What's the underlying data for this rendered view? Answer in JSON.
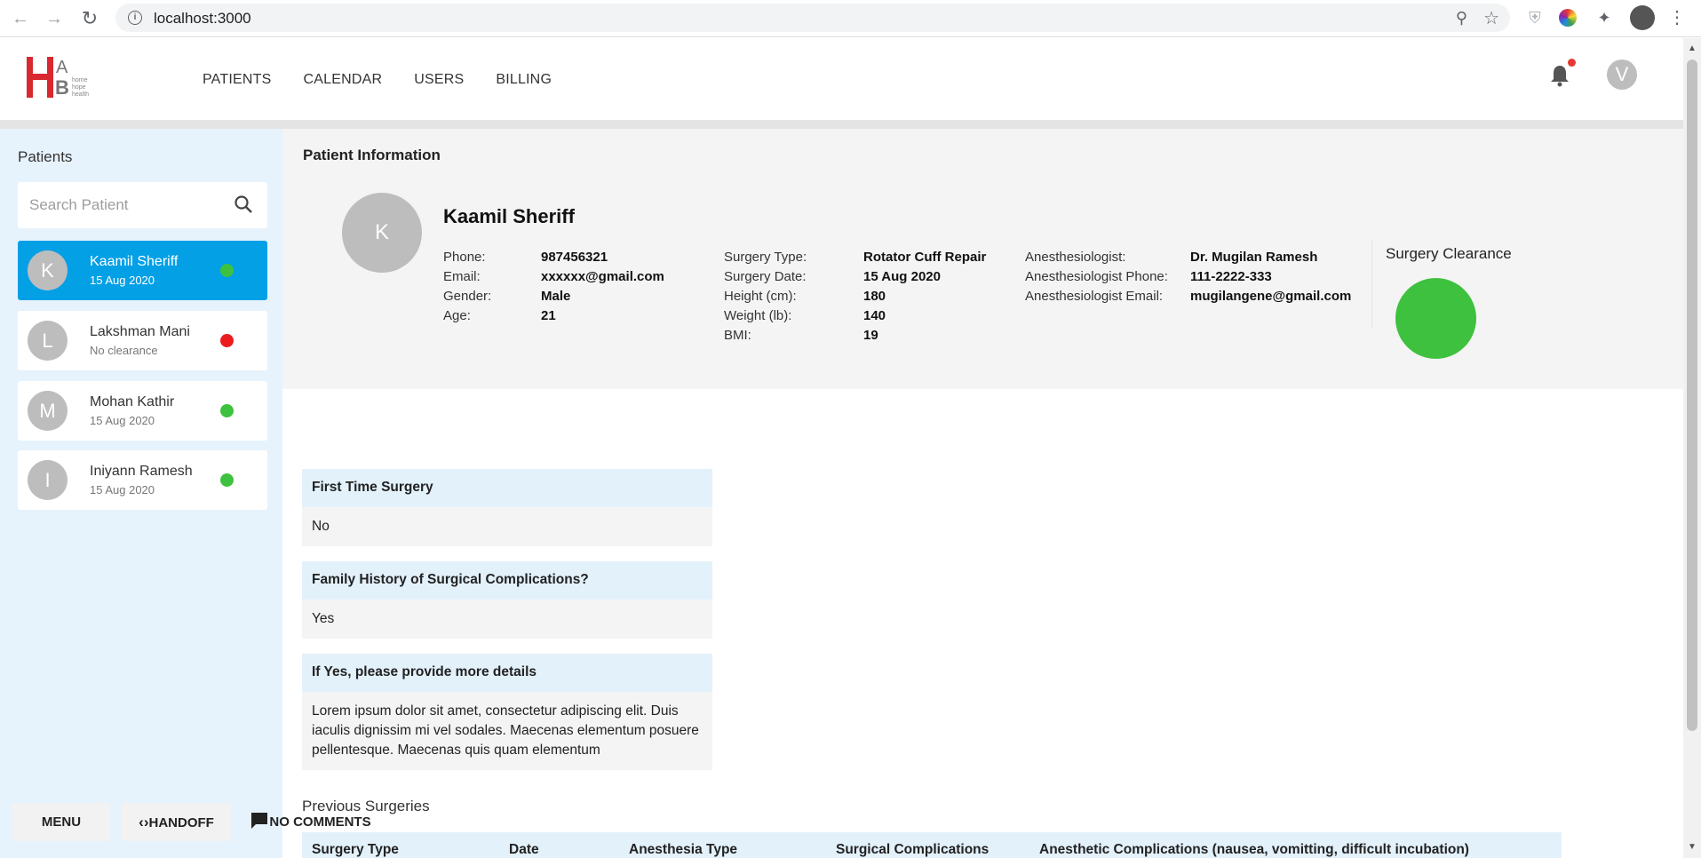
{
  "browser": {
    "url": "localhost:3000",
    "back_icon": "arrow-left-icon",
    "forward_icon": "arrow-right-icon",
    "reload_icon": "reload-icon"
  },
  "header": {
    "logo_text": "HAB",
    "logo_lines": [
      "home",
      "hope",
      "health"
    ],
    "nav": [
      "PATIENTS",
      "CALENDAR",
      "USERS",
      "BILLING"
    ],
    "user_initial": "V",
    "notification_color": "#e53935"
  },
  "sidebar": {
    "title": "Patients",
    "search_placeholder": "Search Patient",
    "patients": [
      {
        "initial": "K",
        "name": "Kaamil Sheriff",
        "subtitle": "15 Aug 2020",
        "status": "green",
        "selected": true
      },
      {
        "initial": "L",
        "name": "Lakshman Mani",
        "subtitle": "No clearance",
        "status": "red",
        "selected": false
      },
      {
        "initial": "M",
        "name": "Mohan Kathir",
        "subtitle": "15 Aug 2020",
        "status": "green",
        "selected": false
      },
      {
        "initial": "I",
        "name": "Iniyann Ramesh",
        "subtitle": "15 Aug 2020",
        "status": "green",
        "selected": false
      }
    ]
  },
  "patient_info": {
    "section_title": "Patient Information",
    "initial": "K",
    "name": "Kaamil Sheriff",
    "col1": [
      {
        "label": "Phone:",
        "value": "987456321"
      },
      {
        "label": "Email:",
        "value": "xxxxxx@gmail.com"
      },
      {
        "label": "Gender:",
        "value": "Male"
      },
      {
        "label": "Age:",
        "value": "21"
      }
    ],
    "col2": [
      {
        "label": "Surgery Type:",
        "value": "Rotator Cuff Repair"
      },
      {
        "label": "Surgery Date:",
        "value": "15 Aug 2020"
      },
      {
        "label": "Height (cm):",
        "value": "180"
      },
      {
        "label": "Weight (lb):",
        "value": "140"
      },
      {
        "label": "BMI:",
        "value": "19"
      }
    ],
    "col3": [
      {
        "label": "Anesthesiologist:",
        "value": "Dr. Mugilan Ramesh"
      },
      {
        "label": "Anesthesiologist Phone:",
        "value": "111-2222-333"
      },
      {
        "label": "Anesthesiologist Email:",
        "value": "mugilangene@gmail.com"
      }
    ],
    "clearance_title": "Surgery Clearance",
    "clearance_color": "#3ec13e"
  },
  "questions": [
    {
      "q": "First Time Surgery",
      "a": "No"
    },
    {
      "q": "Family History of Surgical Complications?",
      "a": "Yes"
    },
    {
      "q": "If Yes, please provide more details",
      "a": "Lorem ipsum dolor sit amet, consectetur adipiscing elit. Duis iaculis dignissim mi vel sodales. Maecenas elementum posuere pellentesque. Maecenas quis quam elementum"
    }
  ],
  "previous_surgeries": {
    "label": "Previous Surgeries",
    "columns": [
      "Surgery Type",
      "Date",
      "Anesthesia Type",
      "Surgical Complications",
      "Anesthetic Complications (nausea, vomitting, difficult incubation)"
    ]
  },
  "bottom_bar": {
    "menu_label": "MENU",
    "handoff_label": "HANDOFF",
    "comments_label": "NO COMMENTS"
  }
}
